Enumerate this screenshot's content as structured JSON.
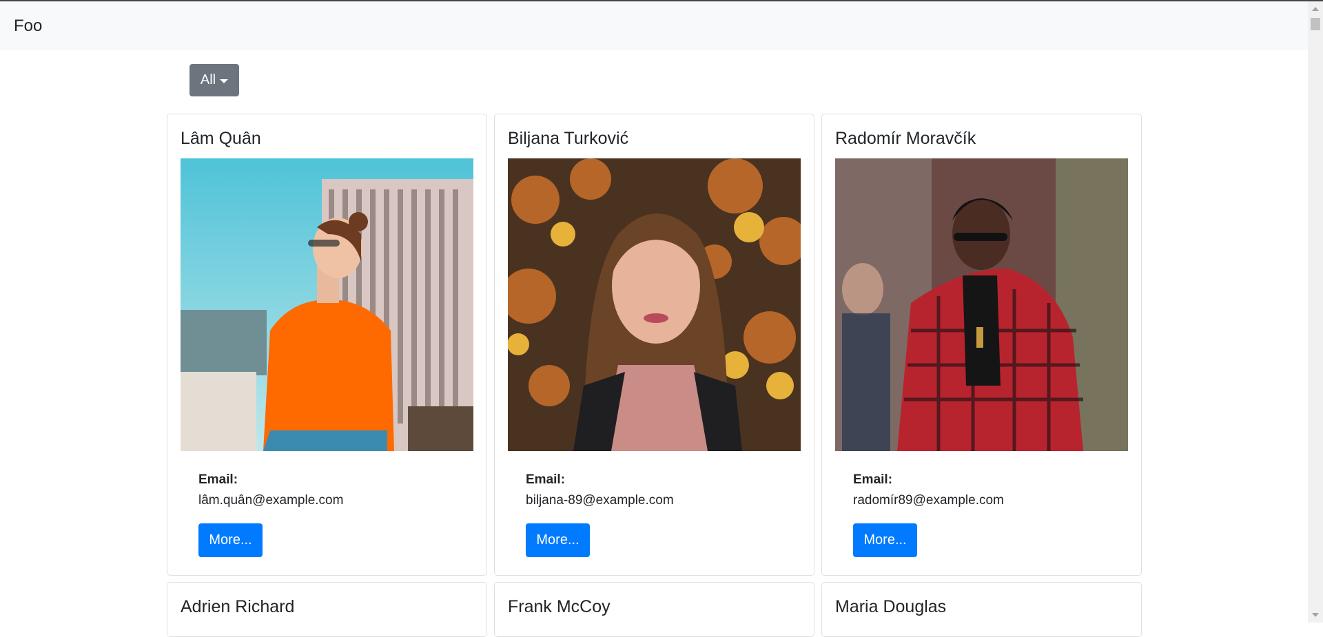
{
  "navbar": {
    "brand": "Foo"
  },
  "filter": {
    "label": "All"
  },
  "cards": [
    {
      "name": "Lâm Quân",
      "email_label": "Email:",
      "email": "lâm.quân@example.com",
      "more_label": "More..."
    },
    {
      "name": "Biljana Turković",
      "email_label": "Email:",
      "email": "biljana-89@example.com",
      "more_label": "More..."
    },
    {
      "name": "Radomír Moravčík",
      "email_label": "Email:",
      "email": "radomír89@example.com",
      "more_label": "More..."
    },
    {
      "name": "Adrien Richard"
    },
    {
      "name": "Frank McCoy"
    },
    {
      "name": "Maria Douglas"
    }
  ],
  "colors": {
    "navbar_bg": "#f8f9fa",
    "filter_button": "#6c757d",
    "primary_button": "#007bff"
  }
}
